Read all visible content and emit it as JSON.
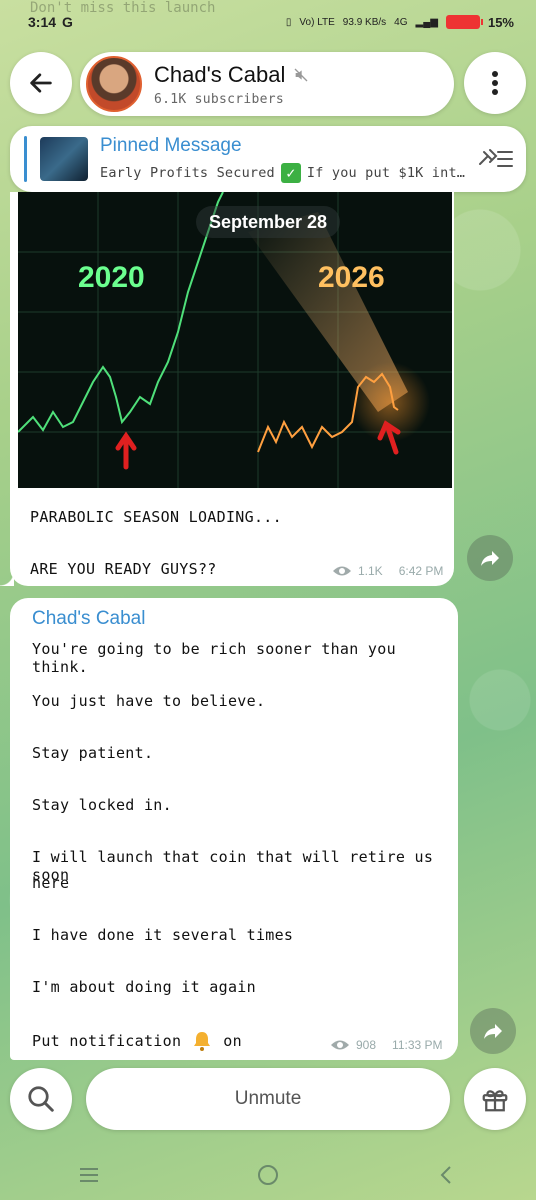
{
  "status_bar": {
    "time": "3:14",
    "g_badge": "G",
    "network_small": "Vo) LTE",
    "speed": "93.9 KB/s",
    "net_type": "4G",
    "battery": "15%",
    "ghost_text": "Don't miss this launch"
  },
  "header": {
    "title": "Chad's Cabal",
    "subscribers": "6.1K subscribers"
  },
  "pinned": {
    "title": "Pinned Message",
    "snippet_before": "Early Profits Secured",
    "snippet_check": "✓",
    "snippet_after": "If you put $1K int…"
  },
  "message1": {
    "date_pill": "September 28",
    "chart_label_left": "2020",
    "chart_label_right": "2026",
    "line1": "PARABOLIC SEASON LOADING...",
    "line2": "ARE YOU READY GUYS??",
    "views": "1.1K",
    "time": "6:42 PM"
  },
  "message2": {
    "sender": "Chad's Cabal",
    "lines": [
      "You're going to be rich sooner than you think.",
      "You just have to believe.",
      "Stay patient.",
      "Stay locked in.",
      "I will launch that coin that will retire us soon",
      "here",
      "I have done it several times",
      "I'm about doing it again",
      "Put notification",
      "on"
    ],
    "views": "908",
    "time": "11:33 PM"
  },
  "bottom": {
    "unmute_label": "Unmute"
  },
  "colors": {
    "accent": "#3a8ed0",
    "green_chart": "#4fe07a",
    "orange_chart": "#ffb040"
  }
}
